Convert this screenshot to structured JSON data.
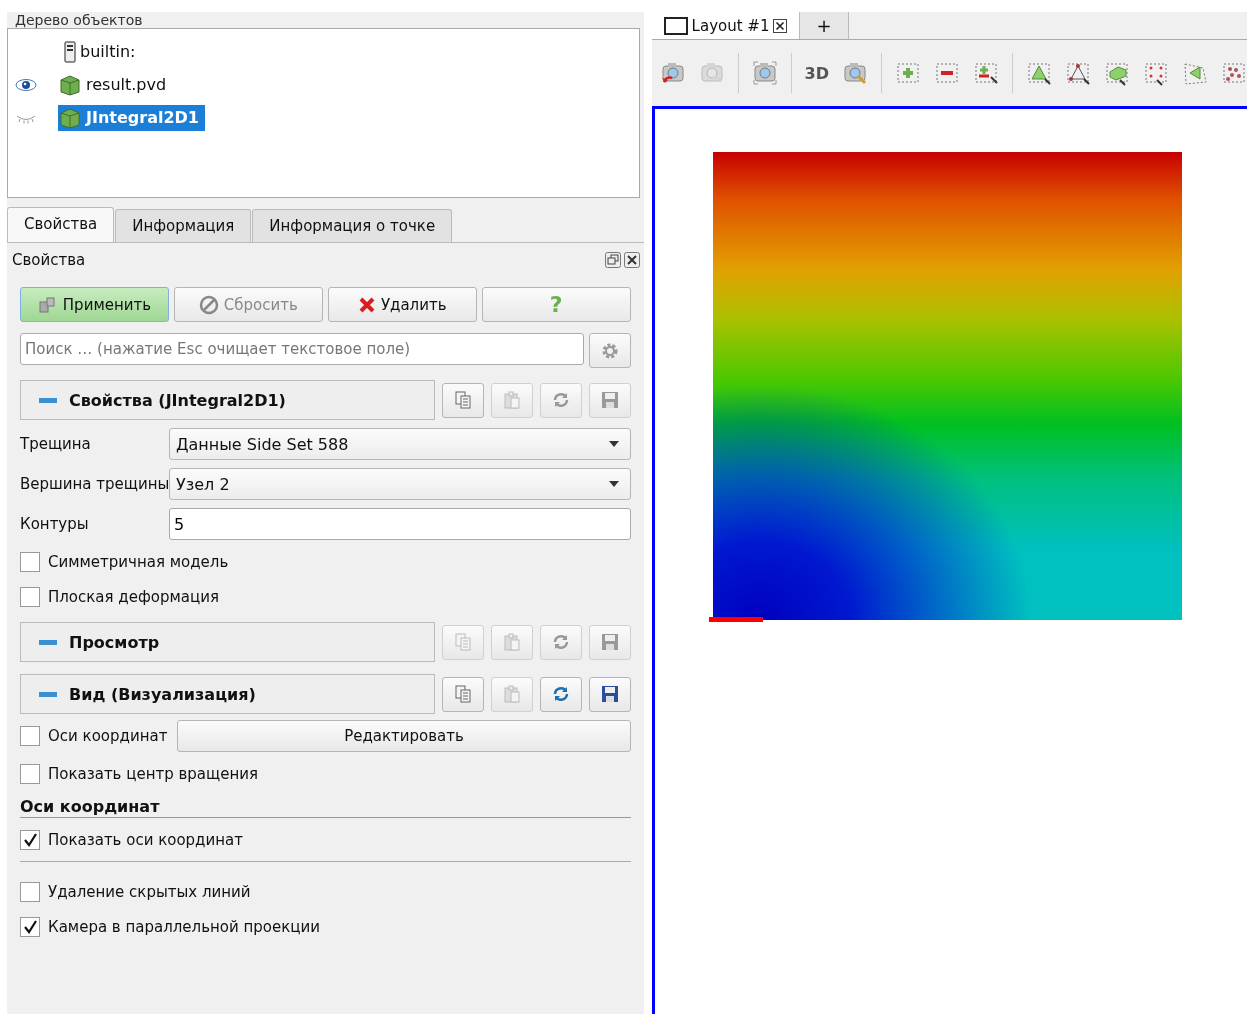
{
  "pipeline_browser": {
    "title": "Дерево объектов",
    "items": [
      {
        "name": "builtin:",
        "kind": "server",
        "selected": false
      },
      {
        "name": "result.pvd",
        "kind": "dataset",
        "visible": true,
        "selected": false
      },
      {
        "name": "JIntegral2D1",
        "kind": "dataset",
        "visible": false,
        "selected": true
      }
    ]
  },
  "tabs": [
    {
      "label": "Свойства",
      "selected": true
    },
    {
      "label": "Информация",
      "selected": false
    },
    {
      "label": "Информация о точке",
      "selected": false
    }
  ],
  "properties": {
    "title": "Свойства",
    "buttons": [
      {
        "label": "Применить",
        "kind": "apply",
        "highlighted": true
      },
      {
        "label": "Сбросить",
        "kind": "reset",
        "disabled": true
      },
      {
        "label": "Удалить",
        "kind": "delete",
        "disabled": false
      },
      {
        "label": "?",
        "kind": "help"
      }
    ],
    "search": {
      "placeholder": "Поиск … (нажатие Esc очищает текстовое поле)"
    },
    "rows": [
      {
        "kind": "section",
        "label": "Свойства (JIntegral2D1)",
        "buttons_enabled": [
          true,
          false,
          false,
          false
        ]
      },
      {
        "kind": "dropdown",
        "label": "Трещина",
        "value": "Данные Side Set 588"
      },
      {
        "kind": "dropdown",
        "label": "Вершина трещины",
        "value": "Узел 2"
      },
      {
        "kind": "text",
        "label": "Контуры",
        "value": "5"
      },
      {
        "kind": "checkbox",
        "label": "Симметричная модель",
        "checked": false
      },
      {
        "kind": "checkbox",
        "label": "Плоская деформация",
        "checked": false
      },
      {
        "kind": "section",
        "label": "Просмотр",
        "buttons_enabled": [
          false,
          false,
          false,
          false
        ]
      },
      {
        "kind": "section",
        "label": "Вид (Визуализация)",
        "buttons_enabled": [
          true,
          false,
          true,
          true
        ]
      },
      {
        "kind": "checkbox_button",
        "label": "Оси координат",
        "checked": false,
        "button": "Редактировать"
      },
      {
        "kind": "checkbox",
        "label": "Показать центр вращения",
        "checked": false
      },
      {
        "kind": "group",
        "label": "Оси координат"
      },
      {
        "kind": "checkbox",
        "label": "Показать оси координат",
        "checked": true
      },
      {
        "kind": "rule"
      },
      {
        "kind": "checkbox",
        "label": "Удаление скрытых линий",
        "checked": false
      },
      {
        "kind": "checkbox",
        "label": "Камера в параллельной проекции",
        "checked": true
      }
    ]
  },
  "viewport": {
    "layout_tabs": [
      {
        "label": "Layout #1",
        "selected": true
      },
      {
        "label": "+",
        "selected": false
      }
    ],
    "toolbar": [
      {
        "kind": "reset-camera"
      },
      {
        "kind": "camera-redo",
        "disabled": true
      },
      {
        "kind": "sep"
      },
      {
        "kind": "screenshot"
      },
      {
        "kind": "sep"
      },
      {
        "kind": "text",
        "label": "3D"
      },
      {
        "kind": "zoom-box"
      },
      {
        "kind": "sep"
      },
      {
        "kind": "select-add"
      },
      {
        "kind": "select-remove"
      },
      {
        "kind": "select-toggle"
      },
      {
        "kind": "sep"
      },
      {
        "kind": "select-cells"
      },
      {
        "kind": "select-points"
      },
      {
        "kind": "select-frustum"
      },
      {
        "kind": "select-frustum-points"
      },
      {
        "kind": "select-polygon"
      },
      {
        "kind": "select-block"
      }
    ]
  }
}
